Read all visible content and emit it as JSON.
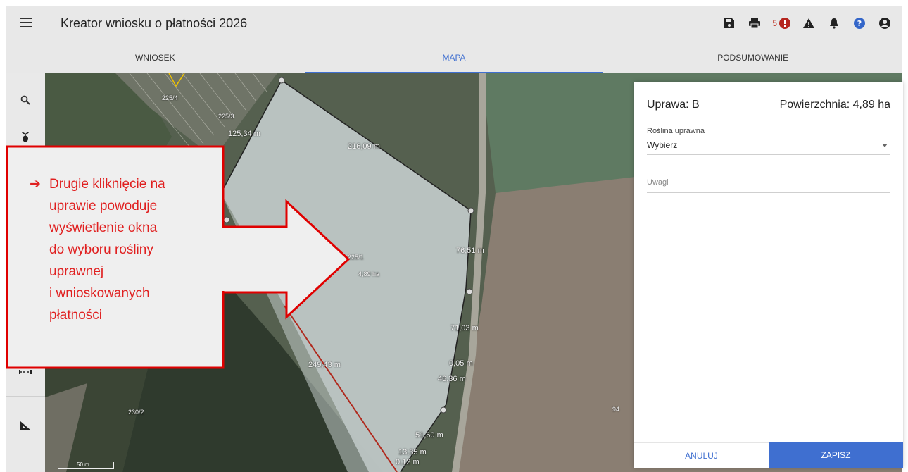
{
  "header": {
    "title": "Kreator wniosku o płatności 2026",
    "error_count": "5",
    "icons": [
      "save-icon",
      "print-icon",
      "error-icon",
      "warning-icon",
      "bell-icon",
      "help-icon",
      "account-icon"
    ]
  },
  "tabs": [
    {
      "label": "WNIOSEK",
      "active": false
    },
    {
      "label": "MAPA",
      "active": true
    },
    {
      "label": "PODSUMOWANIE",
      "active": false
    }
  ],
  "left_tools": [
    "search-icon",
    "plant-icon",
    "ruler-icon",
    "measure-angle-icon"
  ],
  "map": {
    "labels": {
      "parcel_225_4": "225/4",
      "parcel_225_3": "225/3",
      "parcel_225_1": "225/1",
      "parcel_area": "4,89 ha",
      "parcel_230_2": "230/2",
      "parcel_94": "94",
      "edge_125": "125,34 m",
      "edge_216": "216,09 m",
      "edge_76": "76,51 m",
      "edge_71": "71,03 m",
      "edge_0": "0,05 m",
      "edge_46": "46,36 m",
      "edge_249": "249,43 m",
      "edge_51": "51,60 m",
      "edge_13": "13,35 m",
      "edge_0b": "0,12 m"
    },
    "scale_label": "50 m"
  },
  "panel": {
    "crop_label": "Uprawa: B",
    "area_label": "Powierzchnia: 4,89 ha",
    "plant_field_label": "Roślina uprawna",
    "plant_select_value": "Wybierz",
    "notes_placeholder": "Uwagi",
    "cancel_label": "ANULUJ",
    "save_label": "ZAPISZ"
  },
  "callout": {
    "lines": [
      "Drugie kliknięcie na",
      "uprawie powoduje",
      "wyświetlenie okna",
      "do wyboru rośliny",
      "uprawnej",
      "i wnioskowanych",
      "płatności"
    ]
  },
  "colors": {
    "accent": "#3f6fd0",
    "callout_red": "#e02020",
    "error_red": "#c0392b"
  }
}
